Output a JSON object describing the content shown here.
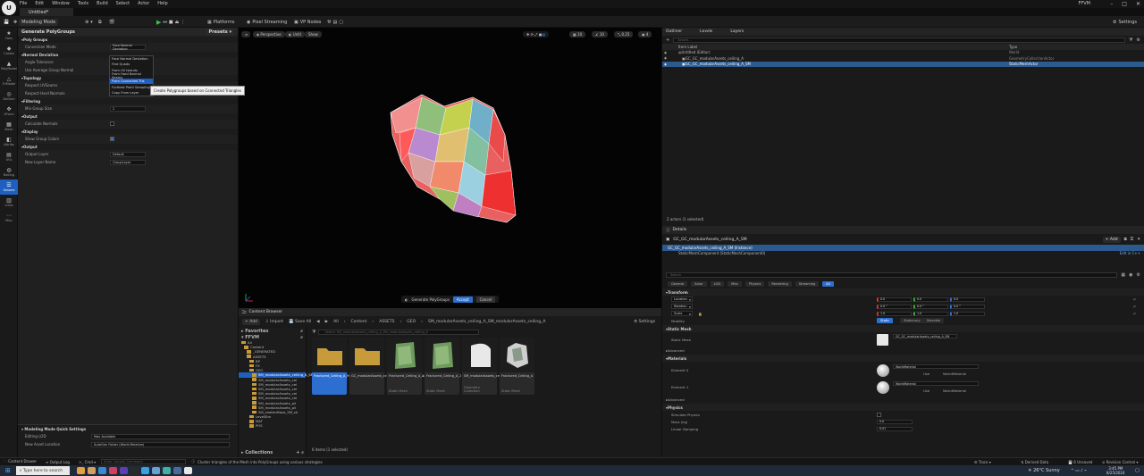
{
  "window": {
    "app_logo": "unreal-engine-logo",
    "doc_tab": "Untitled*",
    "project": "FFVM",
    "menu": [
      "File",
      "Edit",
      "Window",
      "Tools",
      "Build",
      "Select",
      "Actor",
      "Help"
    ]
  },
  "toolbar": {
    "mode": "Modeling Mode",
    "platforms": "Platforms",
    "pixel_streaming": "Pixel Streaming",
    "vp_nodes": "VP Nodes",
    "settings": "Settings"
  },
  "tools": [
    {
      "label": "Favs",
      "icon": "star-icon"
    },
    {
      "label": "Create",
      "icon": "create-icon"
    },
    {
      "label": "PolyModel",
      "icon": "polymodel-icon"
    },
    {
      "label": "TriModel",
      "icon": "trimodel-icon"
    },
    {
      "label": "Deform",
      "icon": "deform-icon"
    },
    {
      "label": "XForm",
      "icon": "xform-icon"
    },
    {
      "label": "Mesh",
      "icon": "mesh-icon"
    },
    {
      "label": "Attribs",
      "icon": "attribs-icon"
    },
    {
      "label": "UVs",
      "icon": "uv-icon"
    },
    {
      "label": "Baking",
      "icon": "bake-icon"
    },
    {
      "label": "Volume",
      "icon": "volume-icon"
    },
    {
      "label": "LODs",
      "icon": "lod-icon"
    },
    {
      "label": "Misc",
      "icon": "misc-icon"
    }
  ],
  "tool_panel": {
    "title": "Generate PolyGroups",
    "presets": "Presets",
    "sections": [
      {
        "title": "Poly Groups",
        "props": [
          {
            "label": "Conversion Mode",
            "value": "Face Normal Deviation"
          }
        ]
      },
      {
        "title": "Normal Deviation",
        "props": [
          {
            "label": "Angle Tolerance",
            "value": ""
          },
          {
            "label": "Use Average Group Normal",
            "value": ""
          }
        ]
      },
      {
        "title": "Topology",
        "props": [
          {
            "label": "Respect UVSeams",
            "check": false
          },
          {
            "label": "Respect Hard Normals",
            "check": false
          }
        ]
      },
      {
        "title": "Filtering",
        "props": [
          {
            "label": "Min Group Size",
            "value": "2"
          }
        ]
      },
      {
        "title": "Output",
        "props": [
          {
            "label": "Calculate Normals",
            "check": false
          }
        ]
      },
      {
        "title": "Display",
        "props": [
          {
            "label": "Show Group Colors",
            "check": true
          }
        ]
      },
      {
        "title": "Output",
        "props": [
          {
            "label": "Output Layer",
            "value": "Default"
          },
          {
            "label": "New Layer Name",
            "value": "GroupLayer"
          }
        ]
      }
    ],
    "dropdown": [
      "Face Normal Deviation",
      "Find Quads",
      "From UV Islands",
      "From Hard Normal Seams",
      "From Connected Tris",
      "Furthest Point Sampling",
      "Copy From Layer"
    ],
    "dropdown_selected": 4,
    "tooltip": "Create Polygroups based on Connected Triangles",
    "quick_settings": {
      "title": "Modeling Mode Quick Settings",
      "rows": [
        {
          "label": "Editing LOD",
          "value": "Max Available"
        },
        {
          "label": "New Asset Location",
          "value": "AutoGen Folder (World-Relative)"
        }
      ]
    }
  },
  "viewport": {
    "perspective": "Perspective",
    "lit": "Unlit",
    "show": "Show",
    "snap": [
      "10",
      "10",
      "0.25",
      "4"
    ],
    "accept_label": "Generate PolyGroups",
    "accept": "Accept",
    "cancel": "Cancel"
  },
  "content_browser": {
    "title": "Content Browser",
    "add": "Add",
    "import": "Import",
    "save_all": "Save All",
    "path": [
      "All",
      "Content",
      "ASSETS",
      "GEO",
      "SM_modularAssets_ceiling_A_SM_modularAssets_ceiling_A"
    ],
    "settings": "Settings",
    "favorites": "Favorites",
    "root": "FFVM",
    "collections": "Collections",
    "search_placeholder": "Search SM_modularAssets_ceiling_A_SM_modularAssets_ceiling_A",
    "tree": [
      {
        "name": "All",
        "d": 0
      },
      {
        "name": "Content",
        "d": 1
      },
      {
        "name": "_GENERATED",
        "d": 2
      },
      {
        "name": "ASSETS",
        "d": 2
      },
      {
        "name": "BP",
        "d": 3
      },
      {
        "name": "FX",
        "d": 3
      },
      {
        "name": "GEO",
        "d": 3
      },
      {
        "name": "SM_modularAssets_ceiling_A_SM",
        "d": 4,
        "sel": true
      },
      {
        "name": "SM_modularAssets_cei",
        "d": 4
      },
      {
        "name": "SM_modularAssets_cei",
        "d": 4
      },
      {
        "name": "SM_modularAssets_cei",
        "d": 4
      },
      {
        "name": "SM_modularAssets_cei",
        "d": 4
      },
      {
        "name": "SM_modularAssets_cei",
        "d": 4
      },
      {
        "name": "SM_modularAssets_pil",
        "d": 4
      },
      {
        "name": "SM_modularAssets_pil",
        "d": 4
      },
      {
        "name": "SM_shatterBase_SM_sh",
        "d": 4
      },
      {
        "name": "LevelSim",
        "d": 3
      },
      {
        "name": "MAT",
        "d": 3
      },
      {
        "name": "POS",
        "d": 3
      }
    ],
    "items": [
      {
        "caption": "Fractured_Ceiling_A_Fractured_Ceiling_A",
        "kind": "folder",
        "sel": true
      },
      {
        "caption": "GC_modularAssets_ceiling_A_GC_modularAssets_",
        "kind": "folder"
      },
      {
        "caption": "Fractured_Ceiling_A_1",
        "type": "Static Mesh",
        "kind": "green"
      },
      {
        "caption": "Fractured_Ceiling_A_2",
        "type": "Static Mesh",
        "kind": "green"
      },
      {
        "caption": "SM_modularAssets_ceiling_A",
        "type": "Geometry Collection",
        "kind": "white"
      },
      {
        "caption": "Fractured_Ceiling_A",
        "type": "Static Mesh",
        "kind": "rock"
      }
    ],
    "status": "6 items (1 selected)"
  },
  "outliner": {
    "tabs": [
      "Outliner",
      "Levels",
      "Layers"
    ],
    "search_placeholder": "Search...",
    "col_label": "Item Label",
    "col_type": "Type",
    "rows": [
      {
        "label": "Untitled (Editor)",
        "type": "World"
      },
      {
        "label": "GC_GC_modularAssets_ceiling_A",
        "type": "GeometryCollectionActor"
      },
      {
        "label": "GC_GC_modularAssets_ceiling_A_SM",
        "type": "StaticMeshActor",
        "sel": true
      }
    ],
    "footer": "2 actors (1 selected)"
  },
  "details": {
    "tab": "Details",
    "actor": "GC_GC_modularAssets_ceiling_A_SM",
    "add": "Add",
    "instance": "GC_GC_modularAssets_ceiling_A_SM (Instance)",
    "component": "StaticMeshComponent (StaticMeshComponent0)",
    "edit_in": "Edit in C++",
    "search_placeholder": "Search",
    "filters": [
      "General",
      "Actor",
      "LOD",
      "Misc",
      "Physics",
      "Rendering",
      "Streaming",
      "All"
    ],
    "transform": {
      "title": "Transform",
      "rows": [
        {
          "label": "Location",
          "v": [
            "0.0",
            "0.0",
            "0.0"
          ]
        },
        {
          "label": "Rotation",
          "v": [
            "0.0 °",
            "0.0 °",
            "0.0 °"
          ]
        },
        {
          "label": "Scale",
          "v": [
            "1.0",
            "1.0",
            "1.0"
          ]
        }
      ],
      "mobility_label": "Mobility",
      "mobility": [
        "Static",
        "Stationary",
        "Movable"
      ]
    },
    "static_mesh": {
      "title": "Static Mesh",
      "label": "Static Mesh",
      "value": "GC_GC_modularAssets_ceiling_A_SM"
    },
    "advanced": "Advanced",
    "materials": {
      "title": "Materials",
      "rows": [
        {
          "label": "Element 0",
          "value": "WorldMaterial",
          "use": "Use",
          "name": "WorldMaterial"
        },
        {
          "label": "Element 1",
          "value": "WorldMaterial",
          "use": "Use",
          "name": "WorldMaterial"
        }
      ]
    },
    "physics": {
      "title": "Physics",
      "rows": [
        {
          "label": "Simulate Physics"
        },
        {
          "label": "Mass (kg)",
          "value": "0.0"
        },
        {
          "label": "Linear Damping",
          "value": "0.01"
        }
      ]
    }
  },
  "statusbar": {
    "content_drawer": "Content Drawer",
    "output_log": "Output Log",
    "cmd": "Cmd",
    "cmd_placeholder": "Enter Console Command",
    "message": "Cluster triangles of the Mesh into PolyGroups using various strategies",
    "trace": "Trace",
    "derived": "Derived Data",
    "unsaved": "6 Unsaved",
    "revision": "Revision Control"
  },
  "taskbar": {
    "search": "Type here to search",
    "weather": "26°C  Sunny",
    "time": "3:45 PM",
    "date": "8/25/2024"
  }
}
